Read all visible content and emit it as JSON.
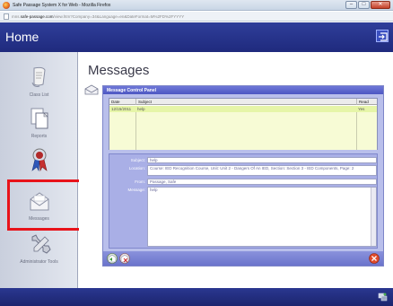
{
  "browser": {
    "window_title": "Safe Passage System X for Web - Mozilla Firefox",
    "url_prefix": "mns.",
    "url_domain": "safe-passage.com",
    "url_rest": "/view.htm?Company=34&Language=en&DateFormat=M%2FD%2FYYYY"
  },
  "app": {
    "title": "Home"
  },
  "sidebar": {
    "items": [
      {
        "label": "Class List",
        "icon": "scroll-icon"
      },
      {
        "label": "Reports",
        "icon": "documents-icon"
      },
      {
        "label": "",
        "icon": "ribbon-badge-icon"
      },
      {
        "label": "Messages",
        "icon": "envelope-icon",
        "selected": true
      },
      {
        "label": "Administrator Tools",
        "icon": "wrench-icon"
      }
    ]
  },
  "main": {
    "title": "Messages",
    "panel_title": "Message Control Panel",
    "grid": {
      "columns": [
        "Date",
        "Subject",
        "Read"
      ],
      "rows": [
        {
          "date": "12/15/2011",
          "subject": "help",
          "read": "Yes"
        }
      ]
    },
    "detail": {
      "subject_label": "Subject:",
      "subject_value": "help",
      "location_label": "Location:",
      "location_value": "Course: IED Recognition Course, Unit: Unit 2 - Dangers Of An IED, Section: Section 3 - IED Components, Page: 2",
      "from_label": "From:",
      "from_value": "Passage, Safe",
      "message_label": "Message:",
      "message_value": "help"
    }
  },
  "colors": {
    "header_blue": "#1f2a7d",
    "panel_purple": "#b9bfeb",
    "selected_row": "#e6f5a8",
    "highlight_red": "#e8131a"
  }
}
